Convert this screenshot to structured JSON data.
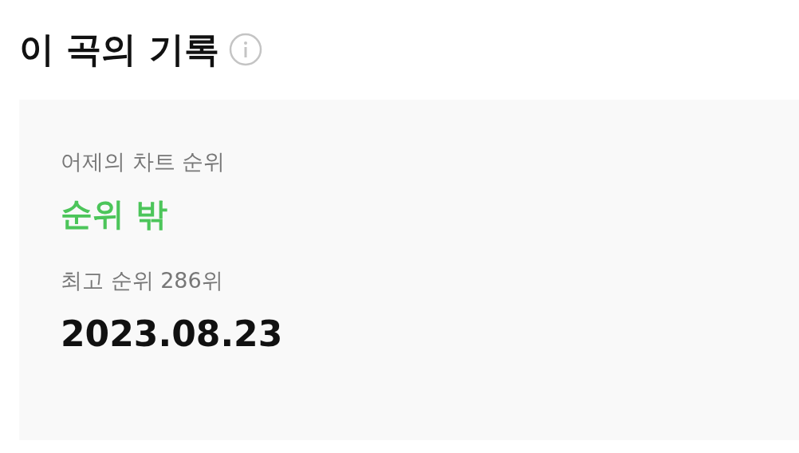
{
  "title": "이 곡의 기록",
  "record": {
    "yesterday_label": "어제의 차트 순위",
    "yesterday_value": "순위 밖",
    "best_label": "최고 순위 286위",
    "best_date": "2023.08.23"
  }
}
